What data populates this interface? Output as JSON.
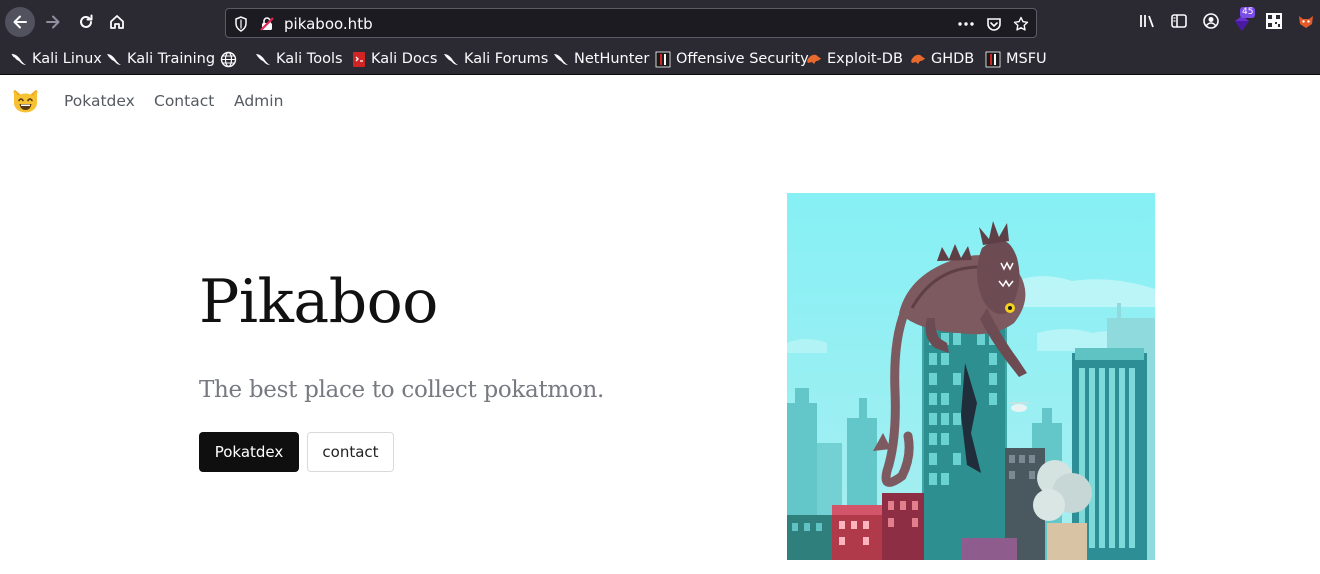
{
  "browser": {
    "url": "pikaboo.htb",
    "extension_badge": "45",
    "bookmarks": [
      {
        "label": "Kali Linux",
        "icon": "kali-dragon-icon"
      },
      {
        "label": "Kali Training",
        "icon": "kali-dragon-icon"
      },
      {
        "label": "",
        "icon": "globe-icon"
      },
      {
        "label": "Kali Tools",
        "icon": "kali-dragon-icon"
      },
      {
        "label": "Kali Docs",
        "icon": "kali-docs-icon"
      },
      {
        "label": "Kali Forums",
        "icon": "kali-dragon-icon"
      },
      {
        "label": "NetHunter",
        "icon": "kali-dragon-icon"
      },
      {
        "label": "Offensive Security",
        "icon": "offsec-icon"
      },
      {
        "label": "Exploit-DB",
        "icon": "exploitdb-icon"
      },
      {
        "label": "GHDB",
        "icon": "exploitdb-icon"
      },
      {
        "label": "MSFU",
        "icon": "offsec-icon"
      }
    ]
  },
  "site": {
    "nav": [
      "Pokatdex",
      "Contact",
      "Admin"
    ],
    "hero_title": "Pikaboo",
    "hero_subtitle": "The best place to collect pokatmon.",
    "primary_button": "Pokatdex",
    "secondary_button": "contact"
  },
  "colors": {
    "chrome_bg": "#2b2a33",
    "urlbar_bg": "#1c1b22",
    "primary_button_bg": "#0f0f10",
    "sky": "#7fe8ef"
  }
}
